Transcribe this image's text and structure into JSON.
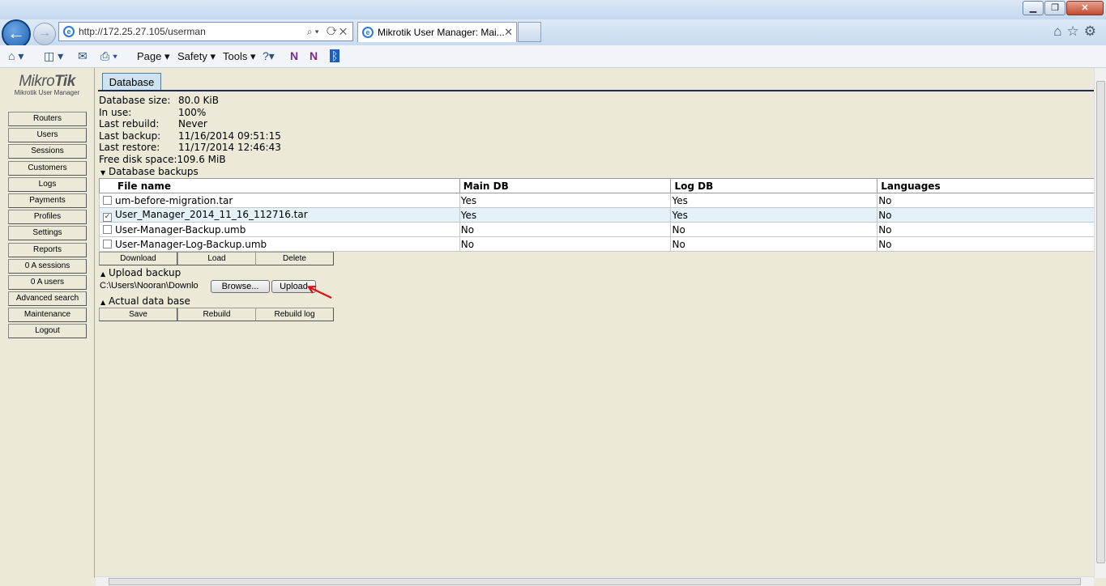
{
  "browser": {
    "url": "http://172.25.27.105/userman",
    "tab_title": "Mikrotik User Manager: Mai...",
    "menu": {
      "page": "Page ▾",
      "safety": "Safety ▾",
      "tools": "Tools ▾"
    }
  },
  "logo": {
    "brand_light": "Mikro",
    "brand_bold": "Tik",
    "subtitle": "Mikrotik User Manager"
  },
  "sidebar": {
    "items": [
      "Routers",
      "Users",
      "Sessions",
      "Customers",
      "Logs",
      "Payments",
      "Profiles",
      "Settings",
      "Reports",
      "0 A sessions",
      "0 A users",
      "Advanced search",
      "Maintenance",
      "Logout"
    ]
  },
  "main_tab": "Database",
  "info": {
    "database_size_label": "Database size:",
    "database_size": "80.0 KiB",
    "in_use_label": "In use:",
    "in_use": "100%",
    "last_rebuild_label": "Last rebuild:",
    "last_rebuild": "Never",
    "last_backup_label": "Last backup:",
    "last_backup": "11/16/2014 09:51:15",
    "last_restore_label": "Last restore:",
    "last_restore": "11/17/2014 12:46:43",
    "free_disk_label": "Free disk space:",
    "free_disk": "109.6 MiB"
  },
  "backups": {
    "header": "Database backups",
    "columns": [
      "File name",
      "Main DB",
      "Log DB",
      "Languages"
    ],
    "rows": [
      {
        "file": "um-before-migration.tar",
        "main": "Yes",
        "log": "Yes",
        "lang": "No",
        "checked": false
      },
      {
        "file": "User_Manager_2014_11_16_112716.tar",
        "main": "Yes",
        "log": "Yes",
        "lang": "No",
        "checked": true
      },
      {
        "file": "User-Manager-Backup.umb",
        "main": "No",
        "log": "No",
        "lang": "No",
        "checked": false
      },
      {
        "file": "User-Manager-Log-Backup.umb",
        "main": "No",
        "log": "No",
        "lang": "No",
        "checked": false
      }
    ],
    "buttons": {
      "download": "Download",
      "load": "Load",
      "delete": "Delete"
    }
  },
  "upload": {
    "header": "Upload backup",
    "file_path": "C:\\Users\\Nooran\\Downlo",
    "browse": "Browse...",
    "upload": "Upload"
  },
  "actual": {
    "header": "Actual data base",
    "buttons": {
      "save": "Save",
      "rebuild": "Rebuild",
      "rebuild_log": "Rebuild log"
    }
  }
}
